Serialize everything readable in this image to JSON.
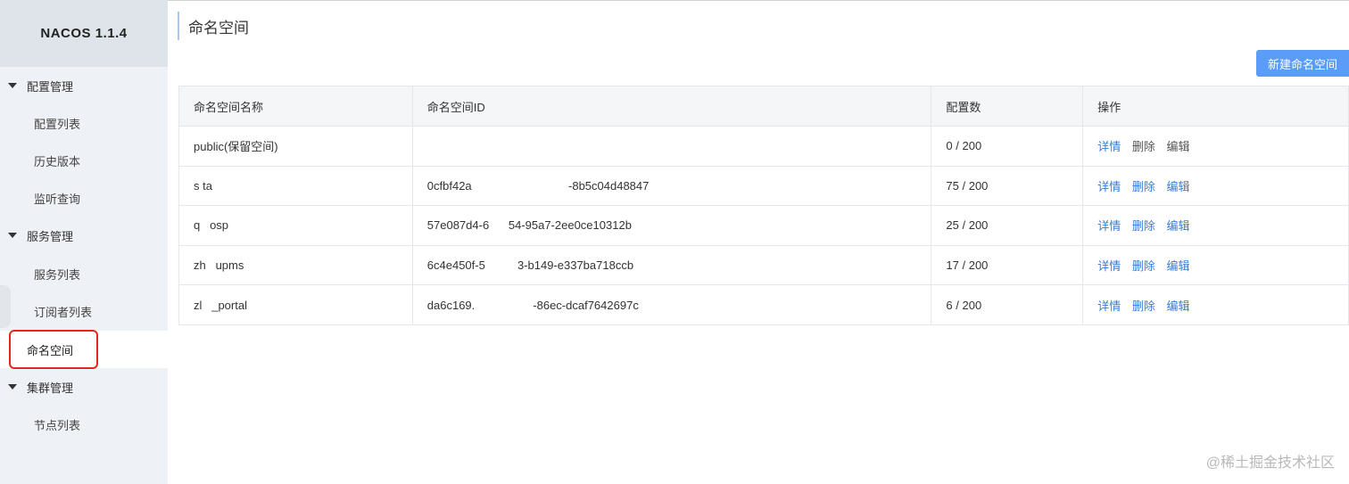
{
  "app": {
    "title": "NACOS 1.1.4"
  },
  "sidebar": {
    "groups": [
      {
        "label": "配置管理",
        "items": [
          "配置列表",
          "历史版本",
          "监听查询"
        ]
      },
      {
        "label": "服务管理",
        "items": [
          "服务列表",
          "订阅者列表",
          "命名空间"
        ]
      },
      {
        "label": "集群管理",
        "items": [
          "节点列表"
        ]
      }
    ],
    "active_item": "命名空间"
  },
  "page": {
    "title": "命名空间",
    "new_button": "新建命名空间"
  },
  "table": {
    "headers": [
      "命名空间名称",
      "命名空间ID",
      "配置数",
      "操作"
    ],
    "rows": [
      {
        "name": "public(保留空间)",
        "id": "",
        "count": "0 / 200",
        "ops": [
          "详情",
          "删除",
          "编辑"
        ]
      },
      {
        "name": "s   ta",
        "id": "0cfbf42a                              -8b5c04d48847",
        "count": "75 / 200",
        "ops": [
          "详情",
          "删除",
          "编辑"
        ]
      },
      {
        "name": "q   osp",
        "id": "57e087d4-6      54-95a7-2ee0ce10312b",
        "count": "25 / 200",
        "ops": [
          "详情",
          "删除",
          "编辑"
        ]
      },
      {
        "name": "zh   upms",
        "id": "6c4e450f-5          3-b149-e337ba718ccb",
        "count": "17 / 200",
        "ops": [
          "详情",
          "删除",
          "编辑"
        ]
      },
      {
        "name": "zl   _portal",
        "id": "da6c169.                  -86ec-dcaf7642697c",
        "count": "6 / 200",
        "ops": [
          "详情",
          "删除",
          "编辑"
        ]
      }
    ]
  },
  "watermark": "@稀土掘金技术社区",
  "colors": {
    "link": "#3a7bd5",
    "primary_button": "#5a9cf8",
    "sidebar_bg": "#eef1f5",
    "highlight_outline": "#e0281f"
  }
}
